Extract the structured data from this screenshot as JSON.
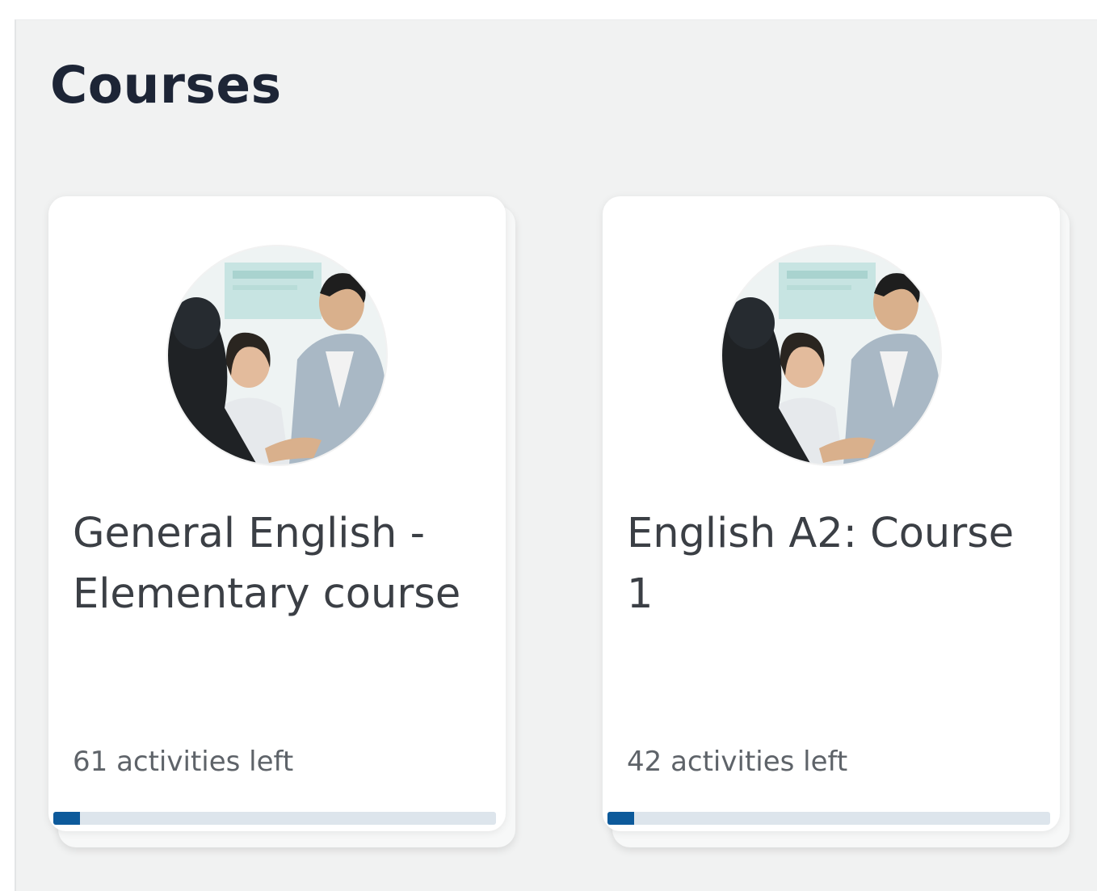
{
  "page": {
    "heading": "Courses"
  },
  "colors": {
    "panel_bg": "#f1f2f2",
    "heading": "#1d2536",
    "progress_fill": "#0d5a9b",
    "progress_track": "#dde5ec"
  },
  "courses": [
    {
      "title": "General English - Elementary course",
      "activities_left": "61 activities left",
      "progress_fraction": 0.06,
      "image": "course-thumbnail-group-of-people"
    },
    {
      "title": "English A2: Course 1",
      "activities_left": "42 activities left",
      "progress_fraction": 0.06,
      "image": "course-thumbnail-group-of-people"
    }
  ]
}
